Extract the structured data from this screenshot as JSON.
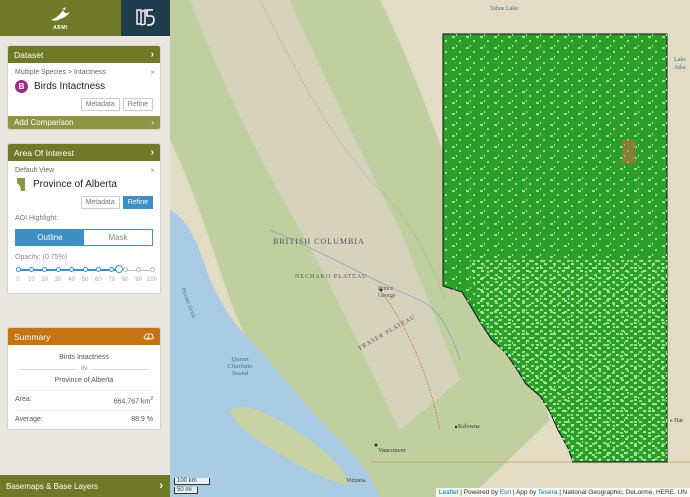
{
  "header": {
    "logo_text": "ABMI"
  },
  "dataset": {
    "header": "Dataset",
    "breadcrumb": "Multiple Species > Intactness",
    "badge": "B",
    "title": "Birds Intactness",
    "metadata_label": "Metadata",
    "refine_label": "Refine",
    "add_comparison": "Add Comparison",
    "close": "×"
  },
  "aoi": {
    "header": "Area Of Interest",
    "sub": "Default View",
    "title": "Province of Alberta",
    "metadata_label": "Metadata",
    "refine_label": "Refine",
    "highlight_label": "AOI Highlight:",
    "outline_label": "Outline",
    "mask_label": "Mask",
    "opacity_label": "Opacity: (0.75%)",
    "opacity_value": 0.75,
    "ticks": [
      "0",
      "10",
      "20",
      "30",
      "40",
      "50",
      "60",
      "70",
      "80",
      "90",
      "100"
    ],
    "close": "×"
  },
  "summary": {
    "header": "Summary",
    "dataset": "Birds Intactness",
    "in": "IN",
    "area_name": "Province of Alberta",
    "area_label": "Area:",
    "area_value": "664,767 km",
    "area_unit_sup": "2",
    "average_label": "Average:",
    "average_value": "88.9 %"
  },
  "basemaps_label": "Basemaps & Base Layers",
  "map": {
    "labels": {
      "bc": "BRITISH COLUMBIA",
      "nechako": "NECHAKO PLATEAU",
      "fraser": "FRASER PLATEAU",
      "prince_george": "Prince George",
      "queen_charlotte": "Queen Charlotte Sound",
      "hecate": "Hecate Strait",
      "vancouver": "Vancouver",
      "kelowna": "Kelowna",
      "victoria": "Victoria",
      "tahoe": "Tahoe Lake",
      "lake": "Lake Atha",
      "medicine_hat": "e Hat"
    },
    "scale_km": "100 km",
    "scale_mi": "50 mi",
    "attribution": {
      "leaflet": "Leaflet",
      "powered": " | Powered by ",
      "esri": "Esri",
      "app": " | App by ",
      "tesera": "Tesera",
      "rest": " | National Geographic, DeLorme, HERE, UN"
    },
    "colors": {
      "intact_dark": "#2e9e2b",
      "intact_light": "#7fe07a",
      "ocean": "#a9cbe3"
    }
  }
}
